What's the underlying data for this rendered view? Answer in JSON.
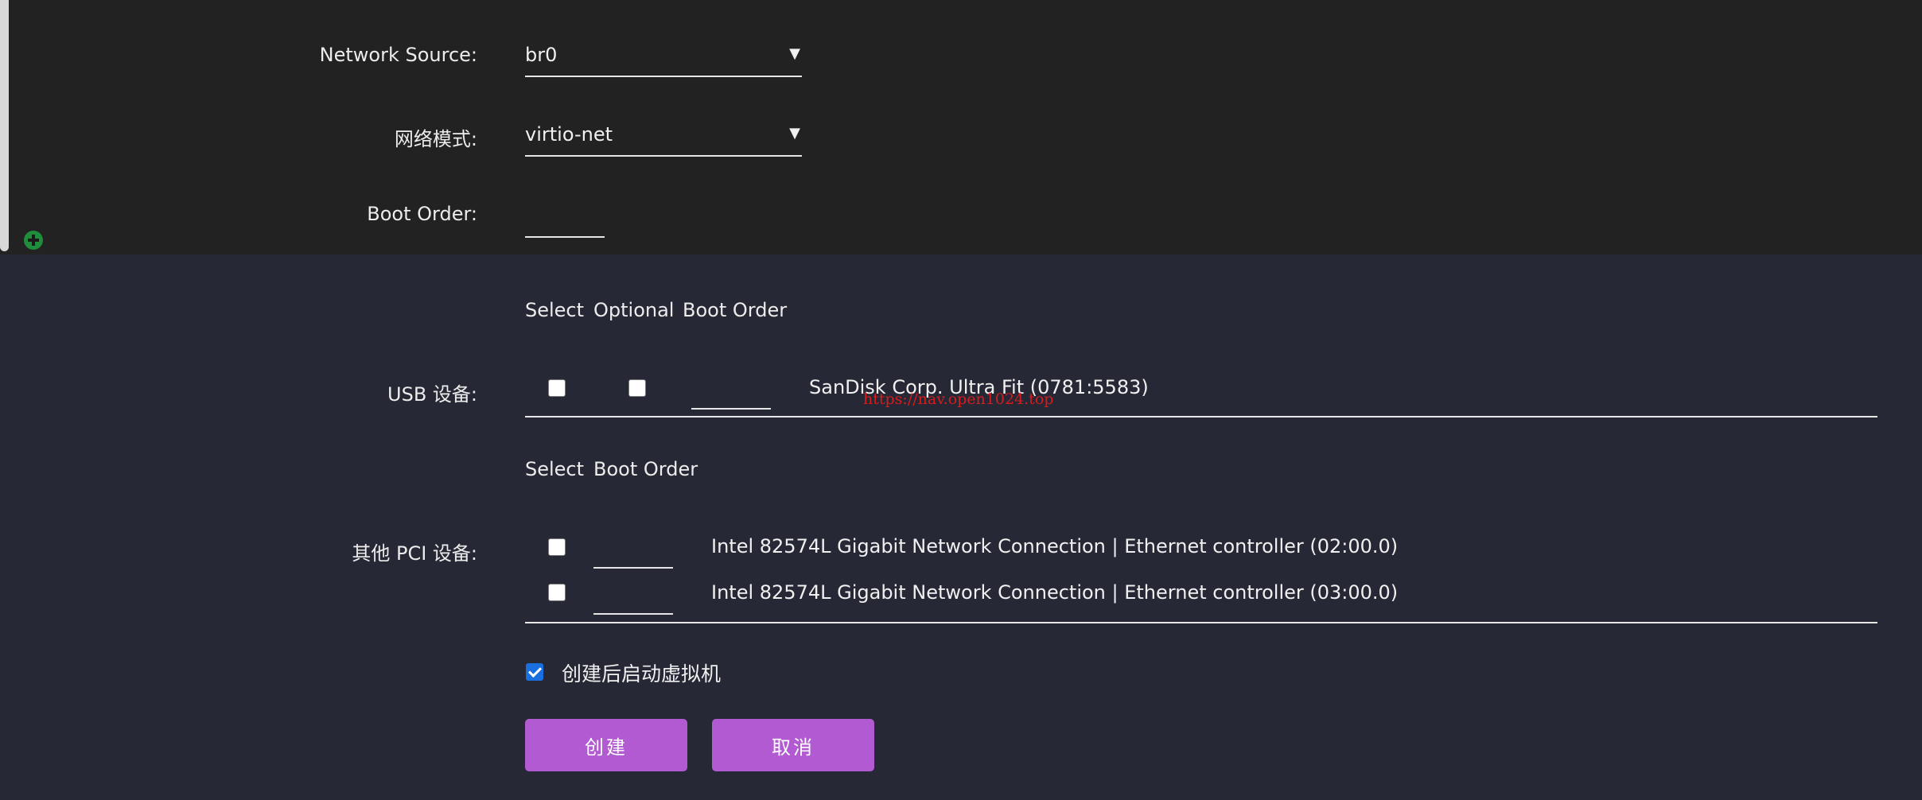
{
  "network": {
    "source_label": "Network Source:",
    "source_value": "br0",
    "mode_label": "网络模式:",
    "mode_value": "virtio-net",
    "boot_order_label": "Boot Order:",
    "dropdown_arrow": "▼"
  },
  "usb": {
    "label": "USB 设备:",
    "headers": [
      "Select",
      "Optional",
      "Boot Order"
    ],
    "devices": [
      {
        "name": "SanDisk Corp. Ultra Fit (0781:5583)",
        "selected": false,
        "optional": false
      }
    ]
  },
  "pci": {
    "label": "其他 PCI 设备:",
    "headers": [
      "Select",
      "Boot Order"
    ],
    "devices": [
      {
        "name": "Intel 82574L Gigabit Network Connection | Ethernet controller (02:00.0)",
        "selected": false
      },
      {
        "name": "Intel 82574L Gigabit Network Connection | Ethernet controller (03:00.0)",
        "selected": false
      }
    ]
  },
  "autostart": {
    "label": "创建后启动虚拟机",
    "checked": true
  },
  "actions": {
    "create_label": "创建",
    "cancel_label": "取消"
  },
  "watermark": "https://nav.open1024.top",
  "colors": {
    "accent": "#b15ad2",
    "checkbox_checked": "#1a6fe0",
    "add_icon": "#1f8d3b",
    "top_panel": "#222222",
    "page_bg": "#272836"
  }
}
